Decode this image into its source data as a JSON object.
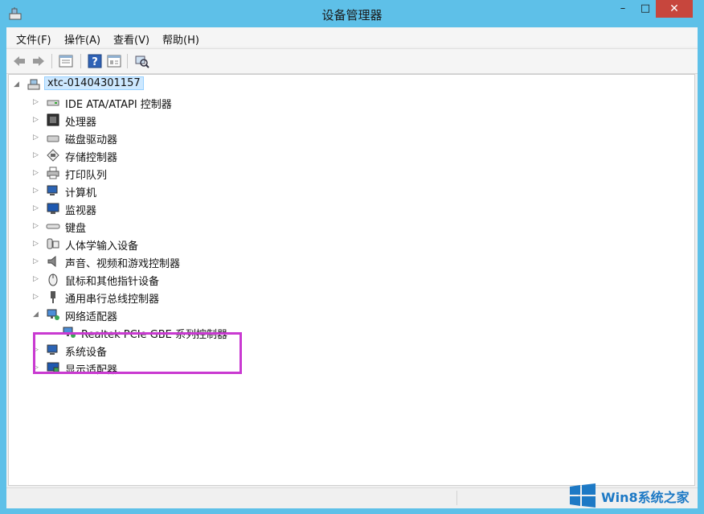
{
  "window": {
    "title": "设备管理器"
  },
  "colors": {
    "frame": "#5ec0e8",
    "close": "#c7463d",
    "highlight_box": "#c93ad1",
    "selection": "#cde8ff"
  },
  "title_buttons": {
    "minimize": "–",
    "maximize": "□",
    "close": "✕"
  },
  "menu": [
    {
      "label": "文件(F)"
    },
    {
      "label": "操作(A)"
    },
    {
      "label": "查看(V)"
    },
    {
      "label": "帮助(H)"
    }
  ],
  "toolbar": [
    {
      "icon": "back-arrow-icon"
    },
    {
      "icon": "forward-arrow-icon"
    },
    {
      "icon": "properties-icon"
    },
    {
      "icon": "help-icon"
    },
    {
      "icon": "details-icon"
    },
    {
      "icon": "scan-hardware-icon"
    }
  ],
  "tree": {
    "root": {
      "label": "xtc-01404301157",
      "expanded": true
    },
    "categories": [
      {
        "label": "IDE ATA/ATAPI 控制器",
        "icon": "ide-controller-icon",
        "expanded": false
      },
      {
        "label": "处理器",
        "icon": "processor-icon",
        "expanded": false
      },
      {
        "label": "磁盘驱动器",
        "icon": "disk-drive-icon",
        "expanded": false
      },
      {
        "label": "存储控制器",
        "icon": "storage-controller-icon",
        "expanded": false
      },
      {
        "label": "打印队列",
        "icon": "printer-icon",
        "expanded": false
      },
      {
        "label": "计算机",
        "icon": "computer-icon",
        "expanded": false
      },
      {
        "label": "监视器",
        "icon": "monitor-icon",
        "expanded": false
      },
      {
        "label": "键盘",
        "icon": "keyboard-icon",
        "expanded": false
      },
      {
        "label": "人体学输入设备",
        "icon": "hid-icon",
        "expanded": false
      },
      {
        "label": "声音、视频和游戏控制器",
        "icon": "speaker-icon",
        "expanded": false
      },
      {
        "label": "鼠标和其他指针设备",
        "icon": "mouse-icon",
        "expanded": false
      },
      {
        "label": "通用串行总线控制器",
        "icon": "usb-icon",
        "expanded": false
      },
      {
        "label": "网络适配器",
        "icon": "network-adapter-icon",
        "expanded": true,
        "children": [
          {
            "label": "Realtek PCIe GBE 系列控制器",
            "icon": "network-adapter-icon"
          }
        ]
      },
      {
        "label": "系统设备",
        "icon": "system-device-icon",
        "expanded": false
      },
      {
        "label": "显示适配器",
        "icon": "display-adapter-icon",
        "expanded": false
      }
    ]
  },
  "watermark": {
    "text": "Win8系统之家"
  }
}
